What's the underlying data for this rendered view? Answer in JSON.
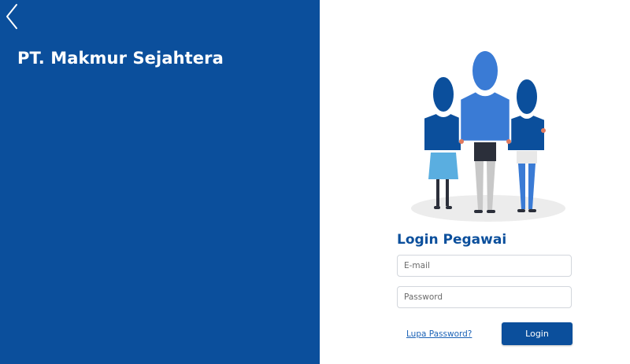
{
  "brand": {
    "company_name": "PT. Makmur Sejahtera"
  },
  "nav": {
    "back_icon": "chevron-left-icon"
  },
  "illustration": {
    "name": "team-people-illustration"
  },
  "login": {
    "title": "Login Pegawai",
    "email_placeholder": "E-mail",
    "email_value": "",
    "password_placeholder": "Password",
    "password_value": "",
    "forgot_label": "Lupa Password?",
    "button_label": "Login"
  },
  "colors": {
    "primary": "#0b4f9c",
    "link": "#1c63b7",
    "background": "#ffffff"
  }
}
